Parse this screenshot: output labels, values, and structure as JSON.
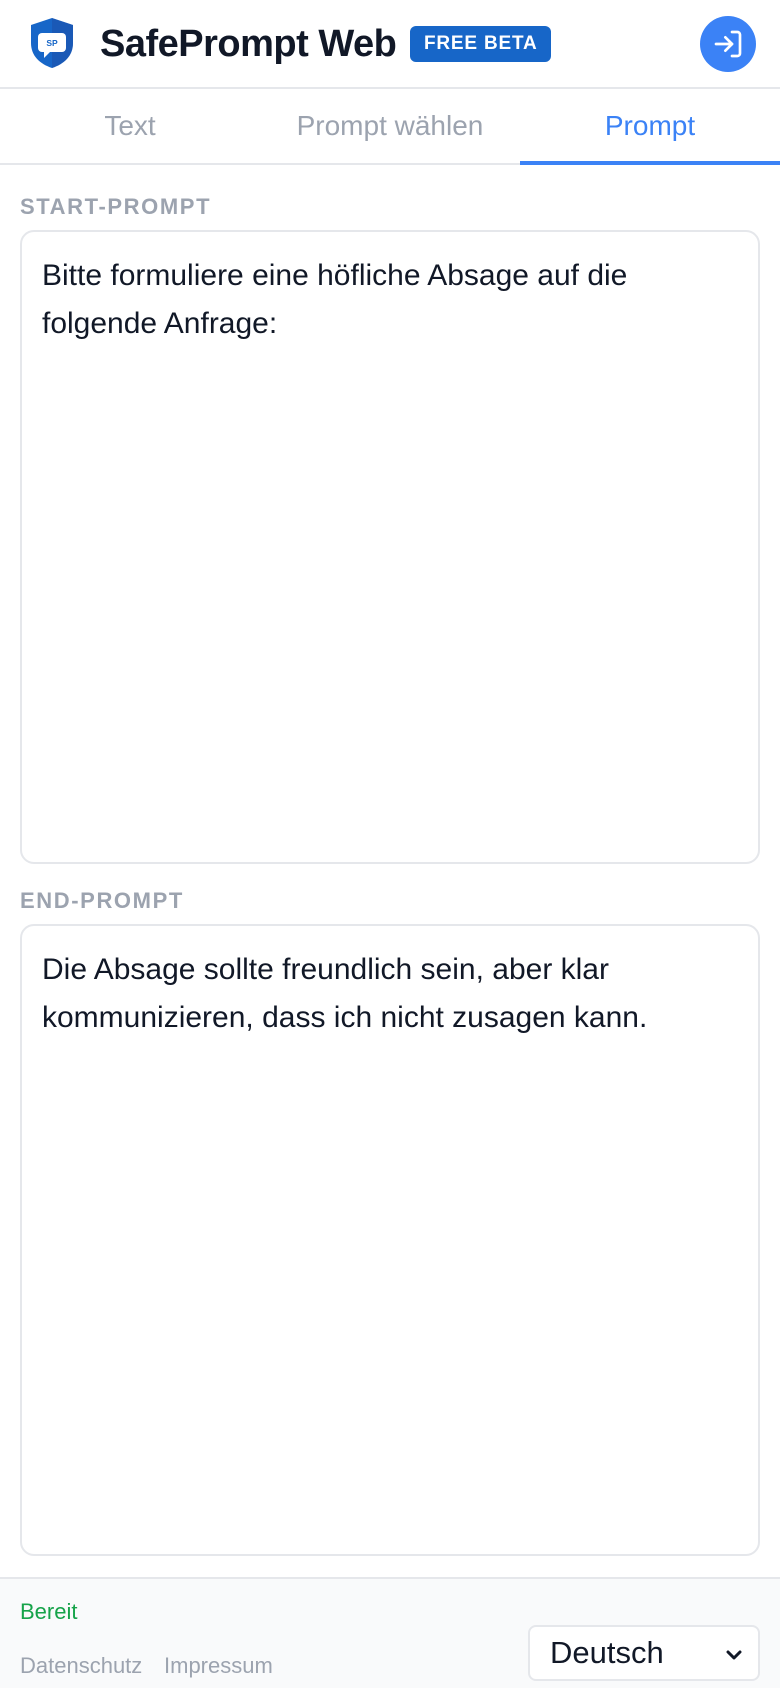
{
  "header": {
    "logo_text": "SP",
    "title": "SafePrompt Web",
    "badge": "FREE BETA",
    "login_icon": "login-arrow-icon"
  },
  "tabs": [
    {
      "label": "Text",
      "active": false
    },
    {
      "label": "Prompt wählen",
      "active": false
    },
    {
      "label": "Prompt",
      "active": true
    }
  ],
  "start_prompt": {
    "label": "START-PROMPT",
    "value": "Bitte formuliere eine höfliche Absage auf die folgende Anfrage:"
  },
  "end_prompt": {
    "label": "END-PROMPT",
    "value": "Die Absage sollte freundlich sein, aber klar kommunizieren, dass ich nicht zusagen kann."
  },
  "footer": {
    "status": "Bereit",
    "links": [
      "Datenschutz",
      "Impressum"
    ],
    "language": "Deutsch"
  },
  "colors": {
    "accent": "#3b82f6",
    "badge": "#1766c8",
    "status_ok": "#16a34a",
    "muted": "#9ca3af"
  }
}
